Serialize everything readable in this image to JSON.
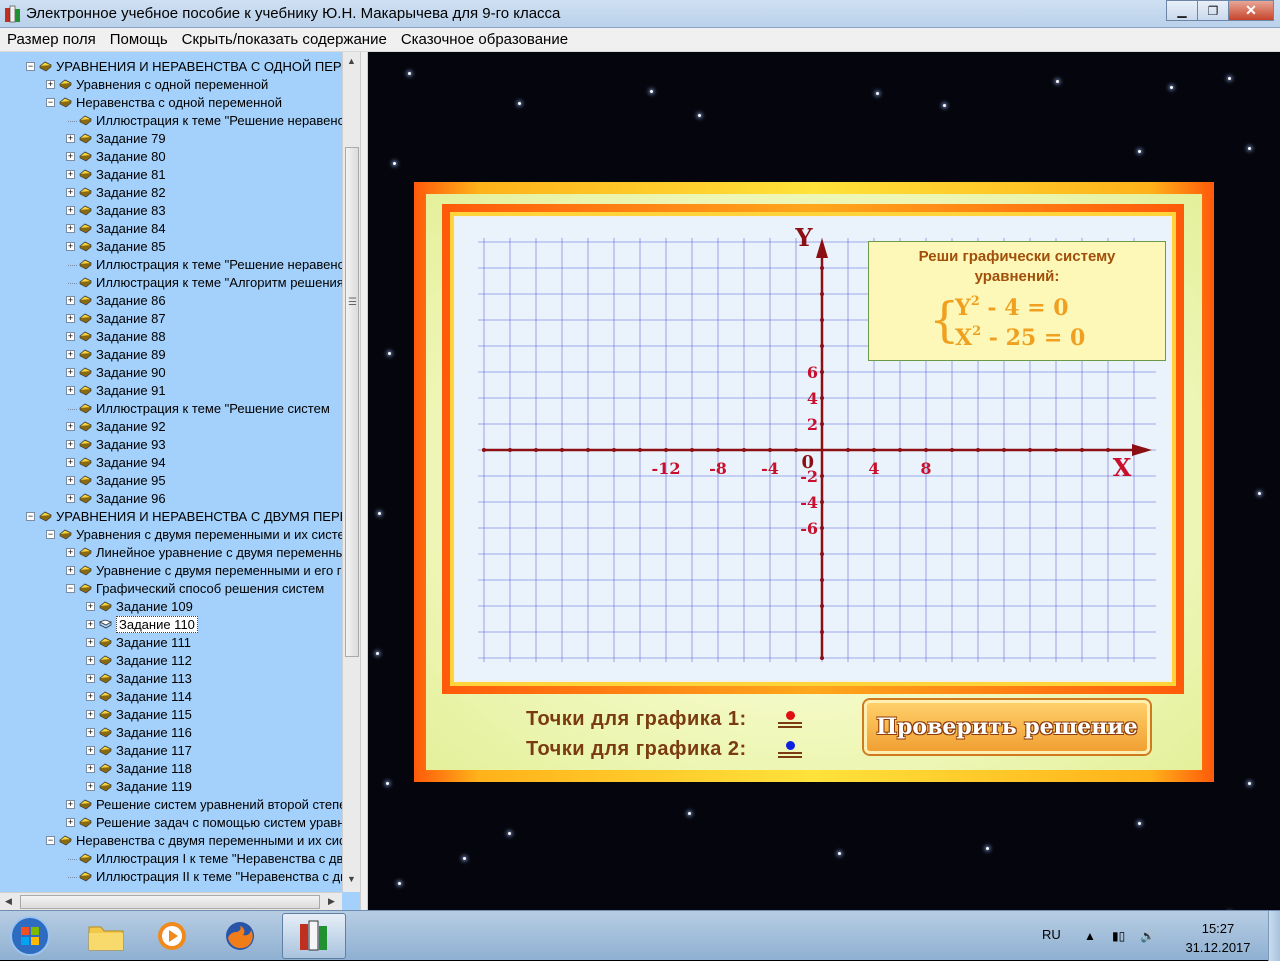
{
  "window": {
    "title": "Электронное учебное пособие к учебнику Ю.Н. Макарычева для 9-го класса",
    "buttons": {
      "minimize": "▁",
      "maximize": "❐",
      "close": "✕"
    }
  },
  "menu": [
    "Размер поля",
    "Помощь",
    "Скрыть/показать содержание",
    "Сказочное образование"
  ],
  "tree": {
    "items": [
      {
        "label": "УРАВНЕНИЯ И НЕРАВЕНСТВА С ОДНОЙ ПЕРЕМЕННОЙ",
        "level": 0,
        "expander": "minus"
      },
      {
        "label": "Уравнения с одной переменной",
        "level": 1,
        "expander": "plus"
      },
      {
        "label": "Неравенства с одной переменной",
        "level": 1,
        "expander": "minus"
      },
      {
        "label": "Иллюстрация к теме \"Решение неравенств",
        "level": 2,
        "expander": "none"
      },
      {
        "label": "Задание 79",
        "level": 2,
        "expander": "plus"
      },
      {
        "label": "Задание 80",
        "level": 2,
        "expander": "plus"
      },
      {
        "label": "Задание 81",
        "level": 2,
        "expander": "plus"
      },
      {
        "label": "Задание 82",
        "level": 2,
        "expander": "plus"
      },
      {
        "label": "Задание 83",
        "level": 2,
        "expander": "plus"
      },
      {
        "label": "Задание 84",
        "level": 2,
        "expander": "plus"
      },
      {
        "label": "Задание 85",
        "level": 2,
        "expander": "plus"
      },
      {
        "label": "Иллюстрация к теме \"Решение неравенств",
        "level": 2,
        "expander": "none"
      },
      {
        "label": "Иллюстрация к теме \"Алгоритм решения",
        "level": 2,
        "expander": "none"
      },
      {
        "label": "Задание 86",
        "level": 2,
        "expander": "plus"
      },
      {
        "label": "Задание 87",
        "level": 2,
        "expander": "plus"
      },
      {
        "label": "Задание 88",
        "level": 2,
        "expander": "plus"
      },
      {
        "label": "Задание 89",
        "level": 2,
        "expander": "plus"
      },
      {
        "label": "Задание 90",
        "level": 2,
        "expander": "plus"
      },
      {
        "label": "Задание 91",
        "level": 2,
        "expander": "plus"
      },
      {
        "label": "Иллюстрация к теме \"Решение систем",
        "level": 2,
        "expander": "none"
      },
      {
        "label": "Задание 92",
        "level": 2,
        "expander": "plus"
      },
      {
        "label": "Задание 93",
        "level": 2,
        "expander": "plus"
      },
      {
        "label": "Задание 94",
        "level": 2,
        "expander": "plus"
      },
      {
        "label": "Задание 95",
        "level": 2,
        "expander": "plus"
      },
      {
        "label": "Задание 96",
        "level": 2,
        "expander": "plus"
      },
      {
        "label": "УРАВНЕНИЯ И НЕРАВЕНСТВА С ДВУМЯ ПЕРЕМЕННЫМИ",
        "level": 0,
        "expander": "minus"
      },
      {
        "label": "Уравнения с двумя переменными и их системы",
        "level": 1,
        "expander": "minus"
      },
      {
        "label": "Линейное уравнение с двумя переменными",
        "level": 2,
        "expander": "plus"
      },
      {
        "label": "Уравнение с двумя переменными и его график",
        "level": 2,
        "expander": "plus"
      },
      {
        "label": "Графический способ решения систем",
        "level": 2,
        "expander": "minus"
      },
      {
        "label": "Задание 109",
        "level": 3,
        "expander": "plus"
      },
      {
        "label": "Задание 110",
        "level": 3,
        "expander": "plus",
        "selected": true
      },
      {
        "label": "Задание 111",
        "level": 3,
        "expander": "plus"
      },
      {
        "label": "Задание 112",
        "level": 3,
        "expander": "plus"
      },
      {
        "label": "Задание 113",
        "level": 3,
        "expander": "plus"
      },
      {
        "label": "Задание 114",
        "level": 3,
        "expander": "plus"
      },
      {
        "label": "Задание 115",
        "level": 3,
        "expander": "plus"
      },
      {
        "label": "Задание 116",
        "level": 3,
        "expander": "plus"
      },
      {
        "label": "Задание 117",
        "level": 3,
        "expander": "plus"
      },
      {
        "label": "Задание 118",
        "level": 3,
        "expander": "plus"
      },
      {
        "label": "Задание 119",
        "level": 3,
        "expander": "plus"
      },
      {
        "label": "Решение систем уравнений второй степени",
        "level": 2,
        "expander": "plus"
      },
      {
        "label": "Решение задач с помощью систем уравнений",
        "level": 2,
        "expander": "plus"
      },
      {
        "label": "Неравенства с двумя переменными и их системы",
        "level": 1,
        "expander": "minus"
      },
      {
        "label": "Иллюстрация I к теме \"Неравенства с двумя",
        "level": 2,
        "expander": "none"
      },
      {
        "label": "Иллюстрация II к теме \"Неравенства с двумя",
        "level": 2,
        "expander": "none"
      }
    ]
  },
  "graph": {
    "axis_x_label": "X",
    "axis_y_label": "Y",
    "origin_label": "0",
    "x_ticks": [
      "-12",
      "-8",
      "-4",
      "4",
      "8"
    ],
    "y_ticks_pos": [
      "6",
      "4",
      "2"
    ],
    "y_ticks_neg": [
      "-2",
      "-4",
      "-6"
    ],
    "colors": {
      "axis": "#8b0f14",
      "grid": "#5b63d6",
      "tick_text": "#c8102e"
    }
  },
  "task": {
    "title_line1": "Реши графически систему",
    "title_line2": "уравнений:",
    "brace": "{",
    "eq1": {
      "var": "Y",
      "exp": "2",
      "rest": " - 4  =  0"
    },
    "eq2": {
      "var": "X",
      "exp": "2",
      "rest": " - 25  =  0"
    }
  },
  "points": {
    "graph1_label": "Точки для графика 1:",
    "graph2_label": "Точки для графика 2:",
    "graph1_color": "#e01010",
    "graph2_color": "#1020e0"
  },
  "check_button": "Проверить решение",
  "taskbar": {
    "lang": "RU",
    "tray": [
      "▲",
      "▮▯",
      "🔊"
    ],
    "time": "15:27",
    "date": "31.12.2017"
  }
}
